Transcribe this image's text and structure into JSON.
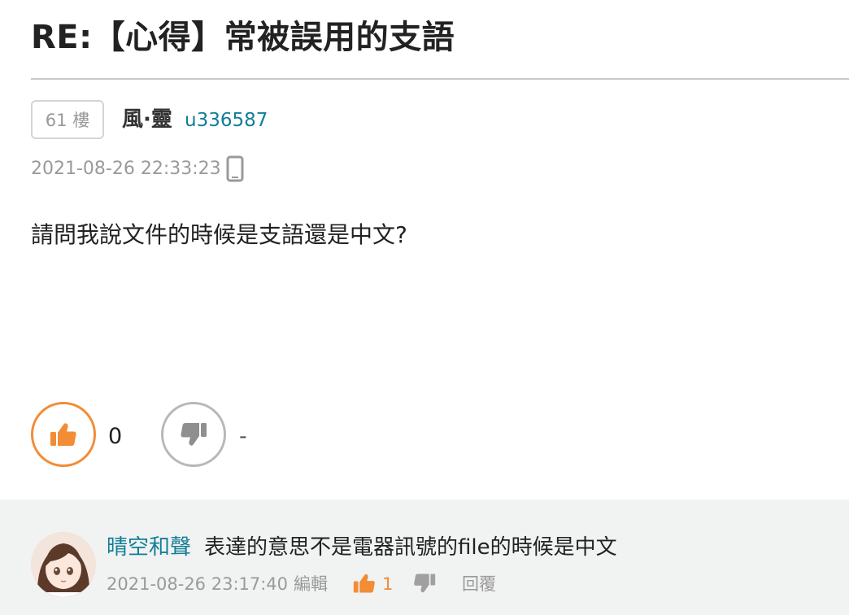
{
  "post": {
    "title": "RE:【心得】常被誤用的支語",
    "floor": "61 樓",
    "author": "風·靈",
    "user_id": "u336587",
    "timestamp": "2021-08-26 22:33:23",
    "device_icon": "mobile-phone-icon",
    "body": "請問我說文件的時候是支語還是中文?",
    "gp_count": "0",
    "bp_count": "-"
  },
  "reply": {
    "author": "晴空和聲",
    "text": "表達的意思不是電器訊號的file的時候是中文",
    "timestamp": "2021-08-26 23:17:40",
    "edit_label": "編輯",
    "gp_count": "1",
    "reply_label": "回覆"
  },
  "colors": {
    "accent": "#f28c35",
    "link": "#117e96",
    "muted": "#9a9a9a",
    "reply_bg": "#f1f2f2"
  }
}
